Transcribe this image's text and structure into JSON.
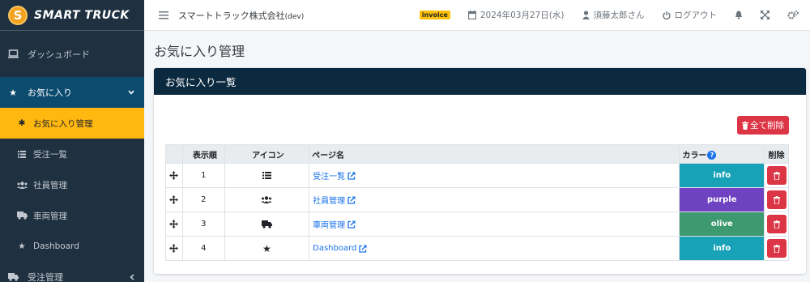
{
  "brand": {
    "logo_letter": "S",
    "name": "SMART TRUCK"
  },
  "sidebar": {
    "items": [
      {
        "label": "ダッシュボード",
        "icon": "laptop-icon"
      },
      {
        "label": "お気に入り",
        "icon": "star-icon",
        "expanded": true
      },
      {
        "label": "受注管理",
        "icon": "truck-icon"
      }
    ],
    "sub_items": [
      {
        "label": "お気に入り管理",
        "icon": "gear-icon",
        "active": true
      },
      {
        "label": "受注一覧",
        "icon": "list-icon"
      },
      {
        "label": "社員管理",
        "icon": "users-icon"
      },
      {
        "label": "車両管理",
        "icon": "truck-icon"
      },
      {
        "label": "Dashboard",
        "icon": "star-icon"
      }
    ]
  },
  "topbar": {
    "company": "スマートトラック株式会社",
    "company_suffix": "(dev)",
    "badge": "invoice",
    "date": "2024年03月27日(水)",
    "user": "須藤太郎さん",
    "logout": "ログアウト"
  },
  "page": {
    "title": "お気に入り管理",
    "card_title": "お気に入り一覧",
    "delete_all_label": "全て削除"
  },
  "table": {
    "headers": {
      "order": "表示順",
      "icon": "アイコン",
      "page": "ページ名",
      "color": "カラー",
      "delete": "削除"
    },
    "rows": [
      {
        "order": "1",
        "icon": "list-icon",
        "page": "受注一覧",
        "color_label": "info",
        "color": "#17a2b8"
      },
      {
        "order": "2",
        "icon": "users-icon",
        "page": "社員管理",
        "color_label": "purple",
        "color": "#6f42c1"
      },
      {
        "order": "3",
        "icon": "truck-icon",
        "page": "車両管理",
        "color_label": "olive",
        "color": "#3d9970"
      },
      {
        "order": "4",
        "icon": "star-icon",
        "page": "Dashboard",
        "color_label": "info",
        "color": "#17a2b8"
      }
    ]
  },
  "colors": {
    "sidebar_bg": "#1f3140",
    "active_sub": "#ffb80f",
    "card_header": "#0b2a40",
    "danger": "#dc3545"
  }
}
